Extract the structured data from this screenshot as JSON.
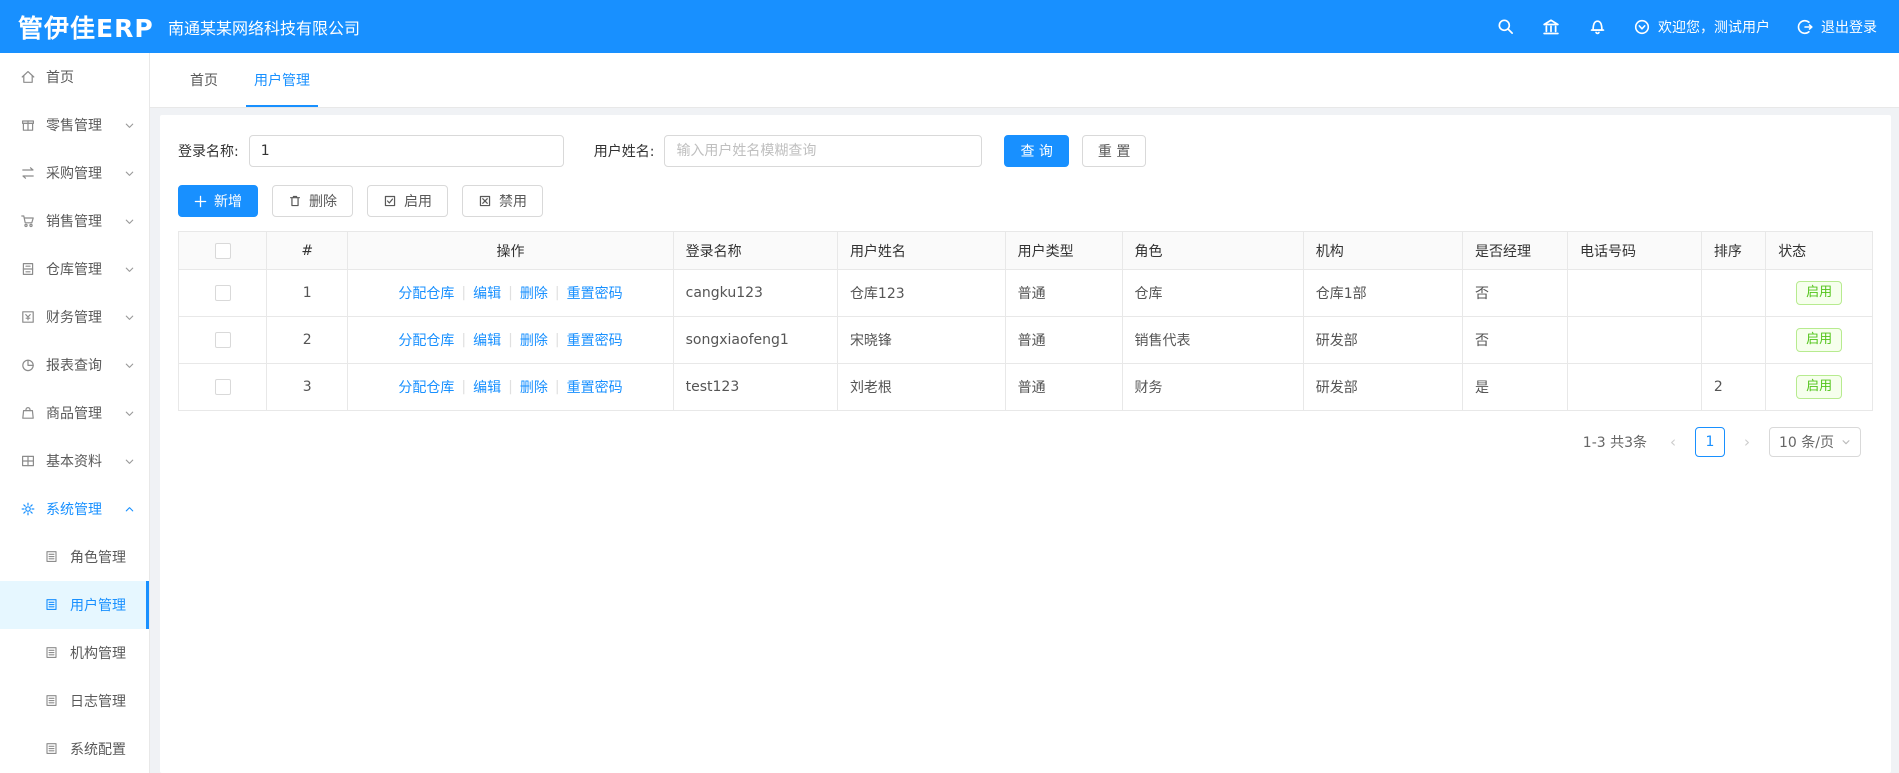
{
  "header": {
    "logo": "管伊佳ERP",
    "company": "南通某某网络科技有限公司",
    "welcome": "欢迎您，测试用户",
    "logout": "退出登录"
  },
  "sidebar": {
    "items": [
      {
        "label": "首页"
      },
      {
        "label": "零售管理"
      },
      {
        "label": "采购管理"
      },
      {
        "label": "销售管理"
      },
      {
        "label": "仓库管理"
      },
      {
        "label": "财务管理"
      },
      {
        "label": "报表查询"
      },
      {
        "label": "商品管理"
      },
      {
        "label": "基本资料"
      },
      {
        "label": "系统管理"
      },
      {
        "label": "角色管理"
      },
      {
        "label": "用户管理"
      },
      {
        "label": "机构管理"
      },
      {
        "label": "日志管理"
      },
      {
        "label": "系统配置"
      }
    ]
  },
  "tabs": [
    {
      "label": "首页"
    },
    {
      "label": "用户管理"
    }
  ],
  "filters": {
    "login_name_label": "登录名称:",
    "login_name_value": "1",
    "user_name_label": "用户姓名:",
    "user_name_placeholder": "输入用户姓名模糊查询",
    "search_label": "查 询",
    "reset_label": "重 置"
  },
  "toolbar": {
    "add": "新增",
    "delete": "删除",
    "enable": "启用",
    "disable": "禁用"
  },
  "table": {
    "columns": {
      "index": "#",
      "actions": "操作",
      "login": "登录名称",
      "name": "用户姓名",
      "type": "用户类型",
      "role": "角色",
      "org": "机构",
      "manager": "是否经理",
      "phone": "电话号码",
      "sort": "排序",
      "status": "状态"
    },
    "action_links": [
      "分配仓库",
      "编辑",
      "删除",
      "重置密码"
    ],
    "rows": [
      {
        "index": "1",
        "login": "cangku123",
        "name": "仓库123",
        "type": "普通",
        "role": "仓库",
        "org": "仓库1部",
        "manager": "否",
        "phone": "",
        "sort": "",
        "status": "启用"
      },
      {
        "index": "2",
        "login": "songxiaofeng1",
        "name": "宋晓锋",
        "type": "普通",
        "role": "销售代表",
        "org": "研发部",
        "manager": "否",
        "phone": "",
        "sort": "",
        "status": "启用"
      },
      {
        "index": "3",
        "login": "test123",
        "name": "刘老根",
        "type": "普通",
        "role": "财务",
        "org": "研发部",
        "manager": "是",
        "phone": "",
        "sort": "2",
        "status": "启用"
      }
    ]
  },
  "pagination": {
    "total": "1-3 共3条",
    "prev": "‹",
    "page": "1",
    "next": "›",
    "page_size": "10 条/页"
  },
  "colors": {
    "primary": "#1890ff",
    "success": "#52c41a",
    "success_border": "#b7eb8f",
    "header_bg": "#1890ff",
    "active_menu_bg": "#e6f7ff"
  }
}
